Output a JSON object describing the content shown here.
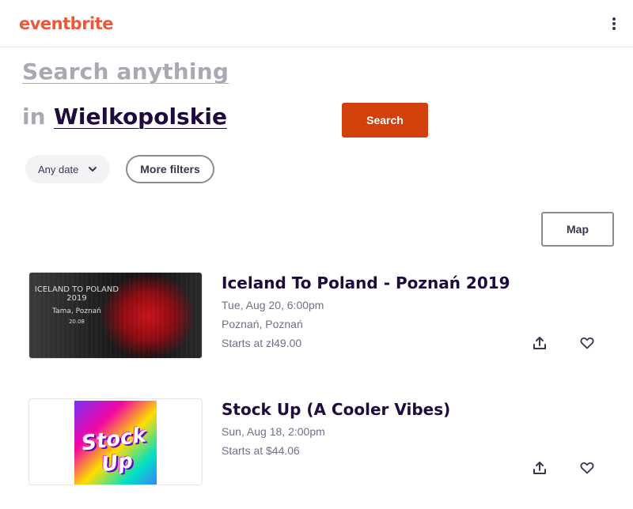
{
  "header": {
    "logo_text": "eventbrite",
    "menu_icon": "kebab-menu-icon"
  },
  "search": {
    "placeholder": "Search anything",
    "in_label": "in",
    "location": "Wielkopolskie",
    "button_label": "Search"
  },
  "filters": {
    "date_label": "Any date",
    "more_filters_label": "More filters"
  },
  "map_button_label": "Map",
  "events": [
    {
      "title": "Iceland To Poland - Poznań 2019",
      "date": "Tue, Aug 20, 6:00pm",
      "location": "Poznań, Poznań",
      "price": "Starts at zł49.00",
      "image_text": {
        "line1": "ICELAND TO POLAND 2019",
        "line2": "Tama, Poznań",
        "line3": "20.08"
      }
    },
    {
      "title": "Stock Up (A Cooler Vibes)",
      "date": "Sun, Aug 18, 2:00pm",
      "price": "Starts at $44.06",
      "image_text": {
        "word": "Stock Up"
      }
    }
  ],
  "colors": {
    "brand": "#f05537",
    "primary_button": "#d1410c",
    "title": "#1e0a3c",
    "muted": "#6f7287"
  }
}
